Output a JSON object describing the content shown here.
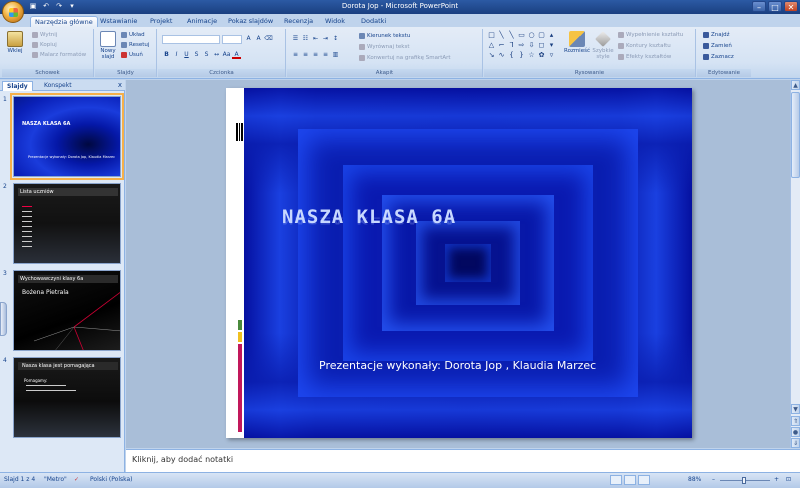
{
  "window": {
    "title": "Dorota Jop - Microsoft PowerPoint",
    "qat": [
      "save-icon",
      "undo-icon",
      "redo-icon",
      "customize-icon"
    ],
    "controls": [
      "minimize",
      "maximize",
      "close"
    ]
  },
  "ribbon_tabs": [
    {
      "label": "Narzędzia główne",
      "active": true
    },
    {
      "label": "Wstawianie"
    },
    {
      "label": "Projekt"
    },
    {
      "label": "Animacje"
    },
    {
      "label": "Pokaz slajdów"
    },
    {
      "label": "Recenzja"
    },
    {
      "label": "Widok"
    },
    {
      "label": "Dodatki"
    }
  ],
  "ribbon": {
    "clipboard": {
      "paste": "Wklej",
      "cut": "Wytnij",
      "copy": "Kopiuj",
      "format_painter": "Malarz formatów",
      "label": "Schowek"
    },
    "slides": {
      "new_slide": "Nowy slajd",
      "layout": "Układ",
      "reset": "Resetuj",
      "delete": "Usuń",
      "label": "Slajdy"
    },
    "font": {
      "label": "Czcionka"
    },
    "paragraph": {
      "text_direction": "Kierunek tekstu",
      "align_text": "Wyrównaj tekst",
      "smartart": "Konwertuj na grafikę SmartArt",
      "label": "Akapit"
    },
    "drawing": {
      "arrange": "Rozmieść",
      "quick_styles": "Szybkie style",
      "fill": "Wypełnienie kształtu",
      "outline": "Kontury kształtu",
      "effects": "Efekty kształtów",
      "label": "Rysowanie"
    },
    "editing": {
      "find": "Znajdź",
      "replace": "Zamień",
      "select": "Zaznacz",
      "label": "Edytowanie"
    }
  },
  "panel": {
    "tabs": [
      "Slajdy",
      "Konspekt"
    ],
    "close": "x",
    "thumbs": [
      {
        "num": "1",
        "title": "NASZA KLASA 6A",
        "sub": "Prezentacje wykonały: Dorota Jop, Klaudia Marzec"
      },
      {
        "num": "2",
        "title": "Lista uczniów"
      },
      {
        "num": "3",
        "title": "Wychowawczyni klasy 6a",
        "sub": "Bożena Pietrala"
      },
      {
        "num": "4",
        "title": "Nasza klasa jest pomagająca",
        "sub": "Pomagamy:"
      }
    ]
  },
  "slide": {
    "title": "NASZA KLASA 6A",
    "subtitle": "Prezentacje wykonały: Dorota Jop , Klaudia Marzec"
  },
  "notes": {
    "placeholder": "Kliknij, aby dodać notatki"
  },
  "status": {
    "slide": "Slajd 1 z 4",
    "theme": "\"Metro\"",
    "language": "Polski (Polska)",
    "zoom": "88%"
  },
  "colors": {
    "slide_bg": "#0a1aa0",
    "ribbon_bg": "#d5e3f4",
    "accent": "#15428b"
  }
}
